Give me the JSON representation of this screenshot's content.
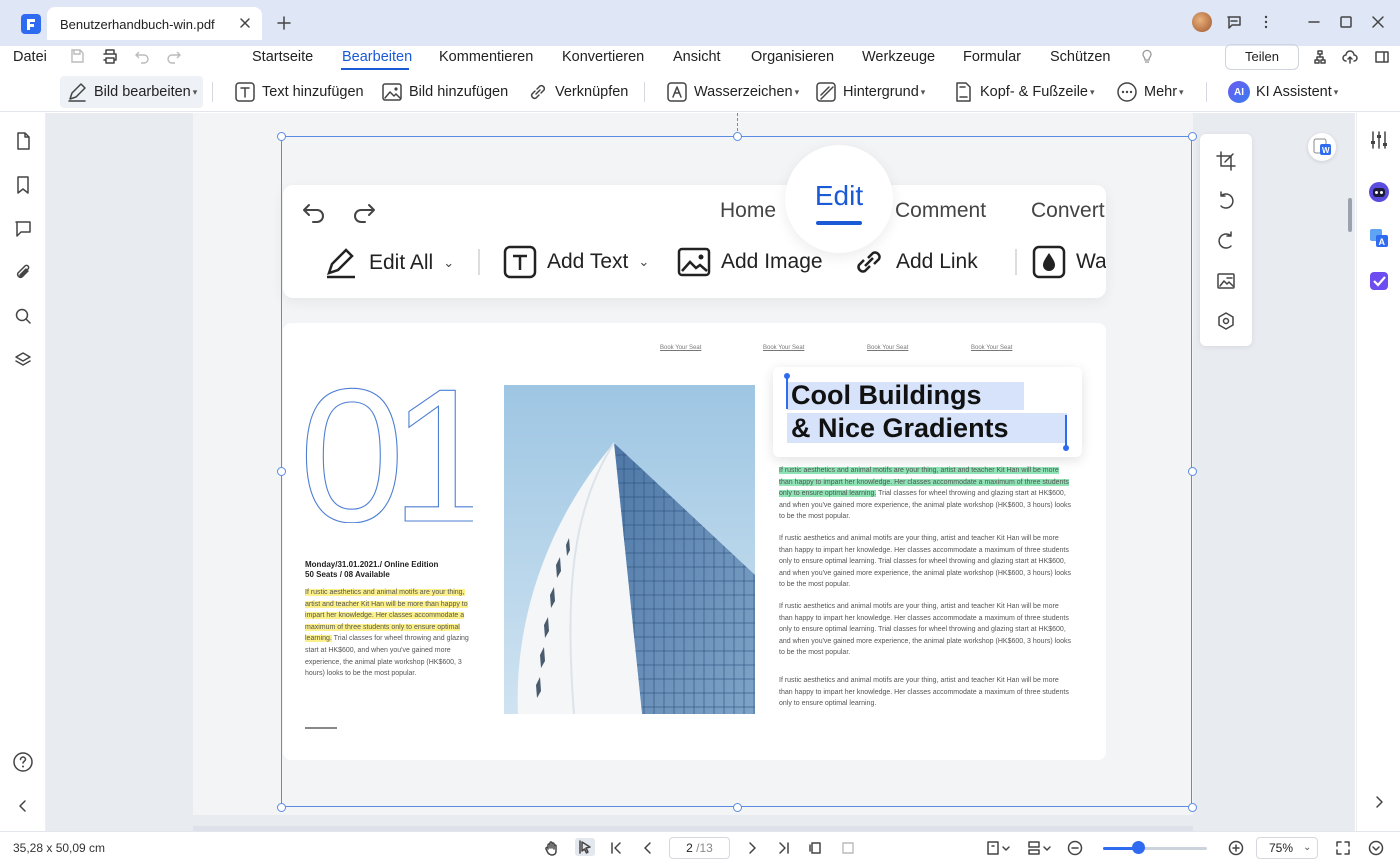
{
  "titlebar": {
    "tab_title": "Benutzerhandbuch-win.pdf"
  },
  "menu": {
    "file": "Datei",
    "items": [
      "Startseite",
      "Bearbeiten",
      "Kommentieren",
      "Konvertieren",
      "Ansicht",
      "Organisieren",
      "Werkzeuge",
      "Formular",
      "Schützen"
    ],
    "active": "Bearbeiten",
    "share": "Teilen"
  },
  "toolbar": {
    "edit_image": "Bild bearbeiten",
    "add_text": "Text hinzufügen",
    "add_image": "Bild hinzufügen",
    "link": "Verknüpfen",
    "watermark": "Wasserzeichen",
    "background": "Hintergrund",
    "header_footer": "Kopf- & Fußzeile",
    "more": "Mehr",
    "ai_badge": "AI",
    "ai_assistant": "KI Assistent"
  },
  "document_image": {
    "tabs": [
      "Home",
      "Comment",
      "Convert"
    ],
    "active_tab": "Edit",
    "tools": [
      "Edit All",
      "Add Text",
      "Add Image",
      "Add Link",
      "Wa"
    ],
    "seat_links": [
      "Book Your Seat",
      "Book Your Seat",
      "Book Your Seat",
      "Book Your Seat"
    ],
    "big_number": "01",
    "event_line1": "Monday/31.01.2021./ Online Edition",
    "event_line2": "50 Seats / 08 Available",
    "left_highlight": "If rustic aesthetics and animal motifs are your thing, artist and teacher Kit Han will be more than happy to impart her knowledge. Her classes accommodate a maximum of three students only to ensure optimal learning.",
    "left_rest": " Trial classes for wheel throwing and glazing start at HK$600, and when you've gained more experience, the animal plate workshop (HK$600, 3 hours) looks to be the most popular.",
    "title_line1": "Cool Buildings",
    "title_line2": "& Nice Gradients",
    "right_highlight": "If rustic aesthetics and animal motifs are your thing, artist and teacher Kit Han will be more than happy to impart her knowledge. Her classes accommodate a maximum of three students only to ensure optimal learning.",
    "right_rest1": " Trial classes for wheel throwing and glazing start at HK$600, and when you've gained more experience, the animal plate workshop (HK$600, 3 hours) looks to be the most popular.",
    "right_para2": "If rustic aesthetics and animal motifs are your thing, artist and teacher Kit Han will be more than happy to impart her knowledge. Her classes accommodate a maximum of three students only to ensure optimal learning. Trial classes for wheel throwing and glazing start at HK$600, and when you've gained more experience, the animal plate workshop (HK$600, 3 hours) looks to be the most popular.",
    "right_para3": "If rustic aesthetics and animal motifs are your thing, artist and teacher Kit Han will be more than happy to impart her knowledge. Her classes accommodate a maximum of three students only to ensure optimal learning. Trial classes for wheel throwing and glazing start at HK$600, and when you've gained more experience, the animal plate workshop (HK$600, 3 hours) looks to be the most popular.",
    "right_para4": "If rustic aesthetics and animal motifs are your thing, artist and teacher Kit Han will be more than happy to impart her knowledge. Her classes accommodate a maximum of three students only to ensure optimal learning."
  },
  "statusbar": {
    "coords": "35,28 x 50,09 cm",
    "current_page": "2",
    "total_pages": "/13",
    "zoom": "75%",
    "zoom_fraction": 0.34
  },
  "colors": {
    "accent": "#1a5ad7",
    "highlight_yellow": "#fbf08a",
    "highlight_green": "#8ee4b5",
    "selection": "#5b8be2"
  }
}
